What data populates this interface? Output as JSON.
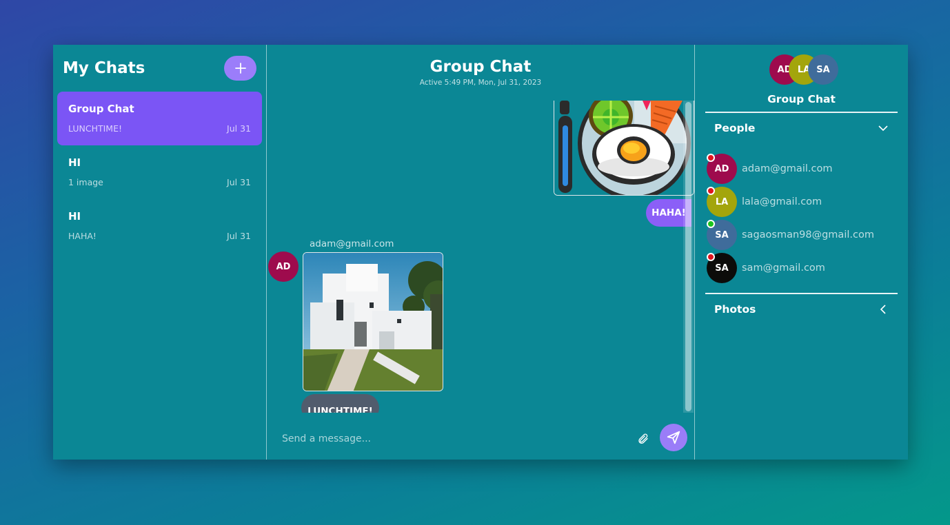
{
  "colors": {
    "panel": "#0b8795",
    "accent": "#7b55f5",
    "button": "#9b7dfa",
    "status_online": "#1bc41b",
    "status_offline": "#e0141e"
  },
  "sidebar": {
    "title": "My Chats",
    "new_chat_icon": "plus-icon",
    "chats": [
      {
        "name": "Group Chat",
        "preview": "LUNCHTIME!",
        "date": "Jul 31",
        "active": true
      },
      {
        "name": "HI",
        "preview": "1 image",
        "date": "Jul 31",
        "active": false
      },
      {
        "name": "HI",
        "preview": "HAHA!",
        "date": "Jul 31",
        "active": false
      }
    ]
  },
  "conversation": {
    "title": "Group Chat",
    "subtitle": "Active 5:49 PM, Mon, Jul 31, 2023",
    "messages": {
      "outgoing_text": "HAHA!",
      "sender": "adam@gmail.com",
      "sender_initials": "AD",
      "incoming_text": "LUNCHTIME!"
    },
    "input_placeholder": "Send a message...",
    "attach_icon": "paperclip-icon",
    "send_icon": "send-icon"
  },
  "details": {
    "avatars": [
      {
        "initials": "AD",
        "color": "#9e0b4d"
      },
      {
        "initials": "LA",
        "color": "#a3a50c"
      },
      {
        "initials": "SA",
        "color": "#3f6c9b"
      }
    ],
    "title": "Group Chat",
    "people_label": "People",
    "photos_label": "Photos",
    "people": [
      {
        "initials": "AD",
        "email": "adam@gmail.com",
        "color": "#9e0b4d",
        "status": "offline"
      },
      {
        "initials": "LA",
        "email": "lala@gmail.com",
        "color": "#a3a50c",
        "status": "offline"
      },
      {
        "initials": "SA",
        "email": "sagaosman98@gmail.com",
        "color": "#3f6c9b",
        "status": "online"
      },
      {
        "initials": "SA",
        "email": "sam@gmail.com",
        "color": "#0c0c0a",
        "status": "offline"
      }
    ]
  }
}
